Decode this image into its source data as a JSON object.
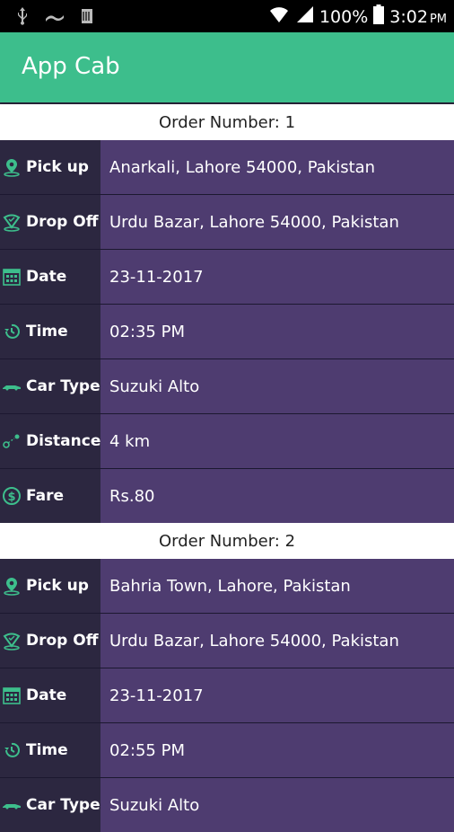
{
  "status_bar": {
    "battery": "100%",
    "time": "3:02",
    "ampm": "PM"
  },
  "app_bar": {
    "title": "App Cab"
  },
  "orders": [
    {
      "header": "Order Number: 1",
      "rows": [
        {
          "label": "Pick up",
          "value": "Anarkali, Lahore 54000, Pakistan",
          "icon": "location-pin-icon"
        },
        {
          "label": "Drop Off",
          "value": "Urdu Bazar, Lahore 54000, Pakistan",
          "icon": "drop-off-pin-icon"
        },
        {
          "label": "Date",
          "value": "23-11-2017",
          "icon": "calendar-icon"
        },
        {
          "label": "Time",
          "value": "02:35 PM",
          "icon": "clock-icon"
        },
        {
          "label": "Car Type",
          "value": "Suzuki Alto",
          "icon": "car-icon"
        },
        {
          "label": "Distance",
          "value": "4 km",
          "icon": "distance-icon"
        },
        {
          "label": "Fare",
          "value": "Rs.80",
          "icon": "dollar-icon"
        }
      ]
    },
    {
      "header": "Order Number: 2",
      "rows": [
        {
          "label": "Pick up",
          "value": "Bahria Town, Lahore, Pakistan",
          "icon": "location-pin-icon"
        },
        {
          "label": "Drop Off",
          "value": "Urdu Bazar, Lahore 54000, Pakistan",
          "icon": "drop-off-pin-icon"
        },
        {
          "label": "Date",
          "value": "23-11-2017",
          "icon": "calendar-icon"
        },
        {
          "label": "Time",
          "value": "02:55 PM",
          "icon": "clock-icon"
        },
        {
          "label": "Car Type",
          "value": "Suzuki Alto",
          "icon": "car-icon"
        }
      ]
    }
  ],
  "colors": {
    "accent": "#3dbe8c",
    "label_bg": "#2c2740",
    "value_bg": "#4e3c70",
    "icon": "#3dbe8c"
  }
}
